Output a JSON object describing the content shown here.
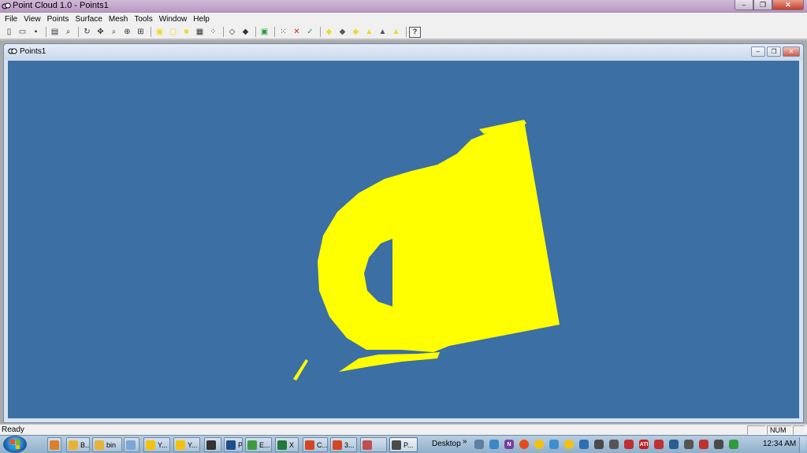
{
  "window": {
    "title": "Point Cloud 1.0 - Points1",
    "controls": {
      "minimize": "–",
      "maximize": "❐",
      "close": "✕"
    }
  },
  "menu": [
    "File",
    "View",
    "Points",
    "Surface",
    "Mesh",
    "Tools",
    "Window",
    "Help"
  ],
  "toolbar": {
    "groups": [
      [
        "new-icon",
        "open-icon",
        "save-icon"
      ],
      [
        "print-icon",
        "print-preview-icon"
      ],
      [
        "rotate-icon",
        "pan-icon",
        "zoom-icon",
        "zoom-window-icon",
        "zoom-fit-icon"
      ],
      [
        "select-points-icon",
        "copy-points-icon",
        "note-icon",
        "grid-icon",
        "scatter-icon"
      ],
      [
        "cube-outline-icon",
        "cube-solid-icon"
      ],
      [
        "export-icon"
      ],
      [
        "point-cloud-icon",
        "delete-points-icon",
        "check-points-icon"
      ],
      [
        "diamond-shape-icon",
        "shaded-diamond-icon",
        "filled-diamond-icon",
        "triangle-shape-icon",
        "shaded-triangle-icon",
        "filled-triangle-icon"
      ],
      [
        "help-icon"
      ]
    ],
    "colors": {
      "yellow": "#f2d72b",
      "green": "#2e9b3d",
      "red": "#cc2a2a",
      "gray": "#555555"
    }
  },
  "child_window": {
    "title": "Points1",
    "controls": {
      "minimize": "–",
      "maximize": "❐",
      "close": "✕"
    },
    "viewport_background": "#3c6fa3",
    "point_color": "#ffff00"
  },
  "status": {
    "text": "Ready",
    "num": "NUM"
  },
  "taskbar": {
    "buttons": [
      {
        "icon": "folder-icon",
        "label": "B...",
        "color": "#e6b33a"
      },
      {
        "icon": "folder-icon",
        "label": "bin",
        "color": "#e6b33a"
      },
      {
        "icon": "network-icon",
        "label": "",
        "color": "#7aa7d6"
      },
      {
        "icon": "messenger-icon",
        "label": "Y...",
        "color": "#f2c20e"
      },
      {
        "icon": "messenger-icon",
        "label": "Y...",
        "color": "#f2c20e"
      },
      {
        "icon": "chip-icon",
        "label": "",
        "color": "#333333"
      },
      {
        "icon": "photoshop-icon",
        "label": "Ps",
        "color": "#1d4f8a"
      },
      {
        "icon": "chrome-icon",
        "label": "E...",
        "color": "#3e9a3e"
      },
      {
        "icon": "excel-icon",
        "label": "X",
        "color": "#1f7a3c"
      },
      {
        "icon": "powerpoint-icon",
        "label": "C...",
        "color": "#d24726"
      },
      {
        "icon": "powerpoint-icon",
        "label": "3...",
        "color": "#d24726"
      },
      {
        "icon": "image-icon",
        "label": "",
        "color": "#c05050"
      },
      {
        "icon": "pointcloud-icon",
        "label": "P...",
        "color": "#4a4a4a"
      }
    ],
    "desktop_label": "Desktop",
    "chevron": "»",
    "tray": [
      {
        "icon": "search-icon",
        "color": "#5c7fa3"
      },
      {
        "icon": "globe-icon",
        "color": "#3b87c7"
      },
      {
        "icon": "onenote-icon",
        "label": "N",
        "color": "#7a3c9e"
      },
      {
        "icon": "smiley-icon",
        "color": "#e64a19"
      },
      {
        "icon": "smiley-icon",
        "color": "#f2c20e"
      },
      {
        "icon": "network-icon",
        "color": "#3e8ed0"
      },
      {
        "icon": "smiley-icon",
        "color": "#f2c20e"
      },
      {
        "icon": "update-icon",
        "color": "#2c6fb5"
      },
      {
        "icon": "speaker-icon",
        "color": "#4a4a4a"
      },
      {
        "icon": "signal-icon",
        "color": "#555555"
      },
      {
        "icon": "flag-icon",
        "color": "#c03030"
      },
      {
        "icon": "ati-icon",
        "label": "ATI",
        "color": "#c22020"
      },
      {
        "icon": "shield-icon",
        "color": "#c03030"
      },
      {
        "icon": "monitor-icon",
        "color": "#2c5d8f"
      },
      {
        "icon": "window-icon",
        "color": "#555555"
      },
      {
        "icon": "security-icon",
        "color": "#c03030"
      },
      {
        "icon": "usb-icon",
        "color": "#4a4a4a"
      },
      {
        "icon": "battery-icon",
        "color": "#2e9b3d"
      }
    ],
    "clock": "12:34 AM"
  }
}
